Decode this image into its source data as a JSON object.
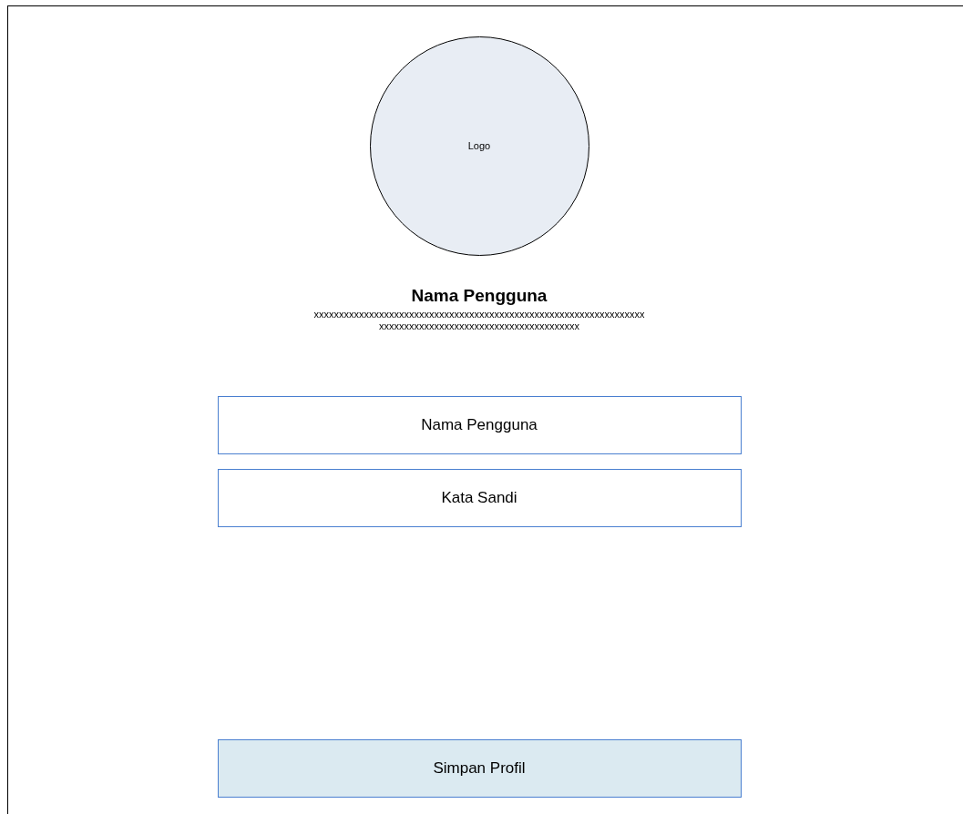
{
  "logo": {
    "label": "Logo"
  },
  "profile": {
    "name": "Nama Pengguna",
    "description_lines": [
      "xxxxxxxxxxxxxxxxxxxxxxxxxxxxxxxxxxxxxxxxxxxxxxxxxxxxxxxxxxxxxxxxxx",
      "xxxxxxxxxxxxxxxxxxxxxxxxxxxxxxxxxxxxxxxx"
    ]
  },
  "fields": [
    {
      "placeholder": "Nama Pengguna"
    },
    {
      "placeholder": "Kata Sandi"
    }
  ],
  "save_button": {
    "label": "Simpan Profil"
  }
}
